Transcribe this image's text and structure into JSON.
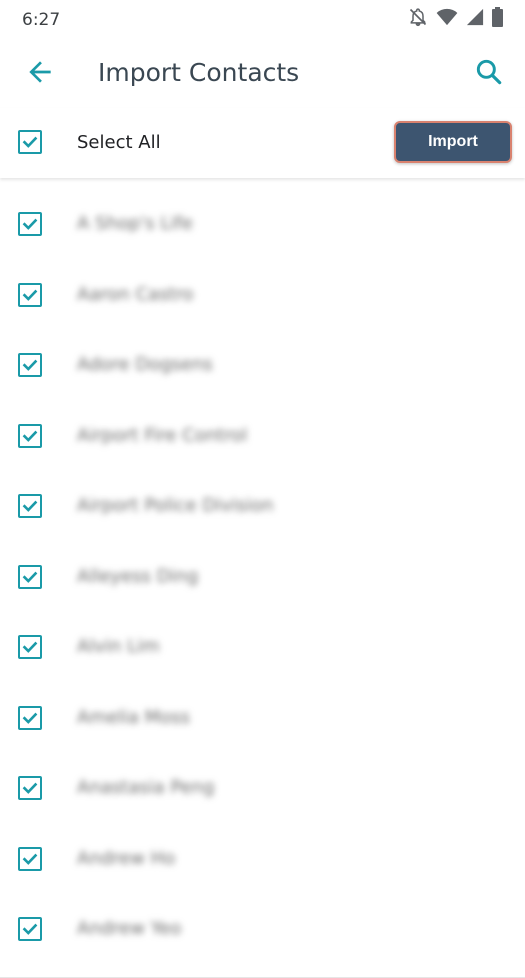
{
  "status_bar": {
    "time": "6:27",
    "icons": [
      "notifications-off-icon",
      "wifi-icon",
      "signal-icon",
      "battery-icon"
    ]
  },
  "app_bar": {
    "title": "Import Contacts",
    "back_icon": "arrow-back-icon",
    "search_icon": "search-icon"
  },
  "select_bar": {
    "select_all_label": "Select All",
    "select_all_checked": true,
    "import_label": "Import"
  },
  "contacts": [
    {
      "name": "A Shop's Life",
      "checked": true
    },
    {
      "name": "Aaron Castro",
      "checked": true
    },
    {
      "name": "Adore Dogsens",
      "checked": true
    },
    {
      "name": "Airport Fire Control",
      "checked": true
    },
    {
      "name": "Airport Police Division",
      "checked": true
    },
    {
      "name": "Alleyess Ding",
      "checked": true
    },
    {
      "name": "Alvin Lim",
      "checked": true
    },
    {
      "name": "Amelia Moss",
      "checked": true
    },
    {
      "name": "Anastasia Peng",
      "checked": true
    },
    {
      "name": "Andrew Ho",
      "checked": true
    },
    {
      "name": "Andrew Yeo",
      "checked": true
    }
  ],
  "colors": {
    "accent": "#1a9aa8",
    "button_bg": "#3d5570",
    "button_border": "#d9826f",
    "title_text": "#3a4752"
  }
}
